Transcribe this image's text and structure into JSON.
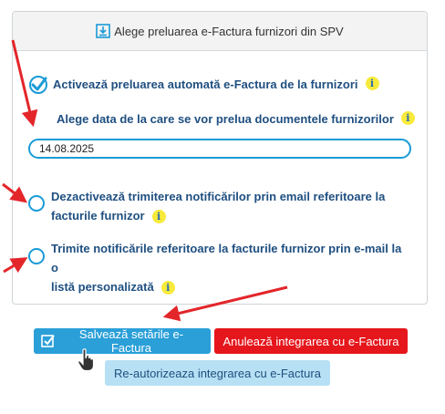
{
  "panel": {
    "title": "Alege preluarea e-Factura furnizori din SPV",
    "title_icon": "download-icon"
  },
  "options": {
    "auto_fetch": {
      "label": "Activează preluarea automată e-Factura de la furnizori",
      "checked": true
    },
    "date_label": "Alege data de la care se vor prelua documentele furnizorilor",
    "date_value": "14.08.2025",
    "disable_email": {
      "line1": "Dezactivează trimiterea notificărilor prin email referitoare la",
      "line2": "facturile furnizor",
      "checked": false
    },
    "custom_list": {
      "line1": "Trimite notificările referitoare la facturile furnizor prin e-mail la o",
      "line2": "listă personalizată",
      "checked": false
    },
    "info_glyph": "i"
  },
  "buttons": {
    "save": "Salvează setările e-Factura",
    "cancel": "Anulează integrarea cu e-Factura",
    "reauth": "Re-autorizeaza integrarea cu e-Factura"
  },
  "colors": {
    "accent": "#1a9bd7",
    "danger": "#e5161c",
    "arrow": "#e3262a",
    "info_badge": "#f7ea3a"
  }
}
